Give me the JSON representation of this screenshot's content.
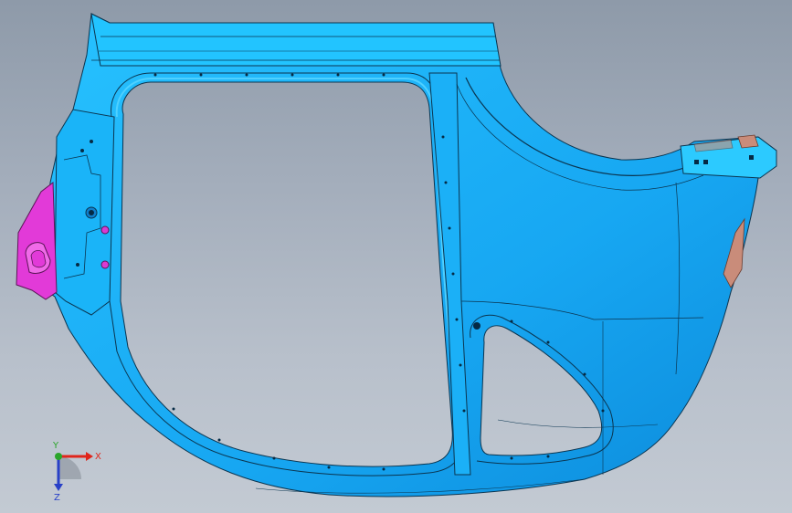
{
  "viewport": {
    "background_top": "#8e9aa9",
    "background_bottom": "#c3cad3"
  },
  "model": {
    "part_color": "#1fb2f5",
    "part_highlight": "#6fd4ff",
    "part_shadow": "#0a86d6",
    "edge_color": "#0b3550",
    "accent_part_color": "#e23ad8",
    "trim_color": "#c98c7a"
  },
  "triad": {
    "x_label": "X",
    "y_label": "Y",
    "z_label": "Z",
    "x_color": "#e0251b",
    "y_color": "#2aa52a",
    "z_color": "#2840c8"
  }
}
